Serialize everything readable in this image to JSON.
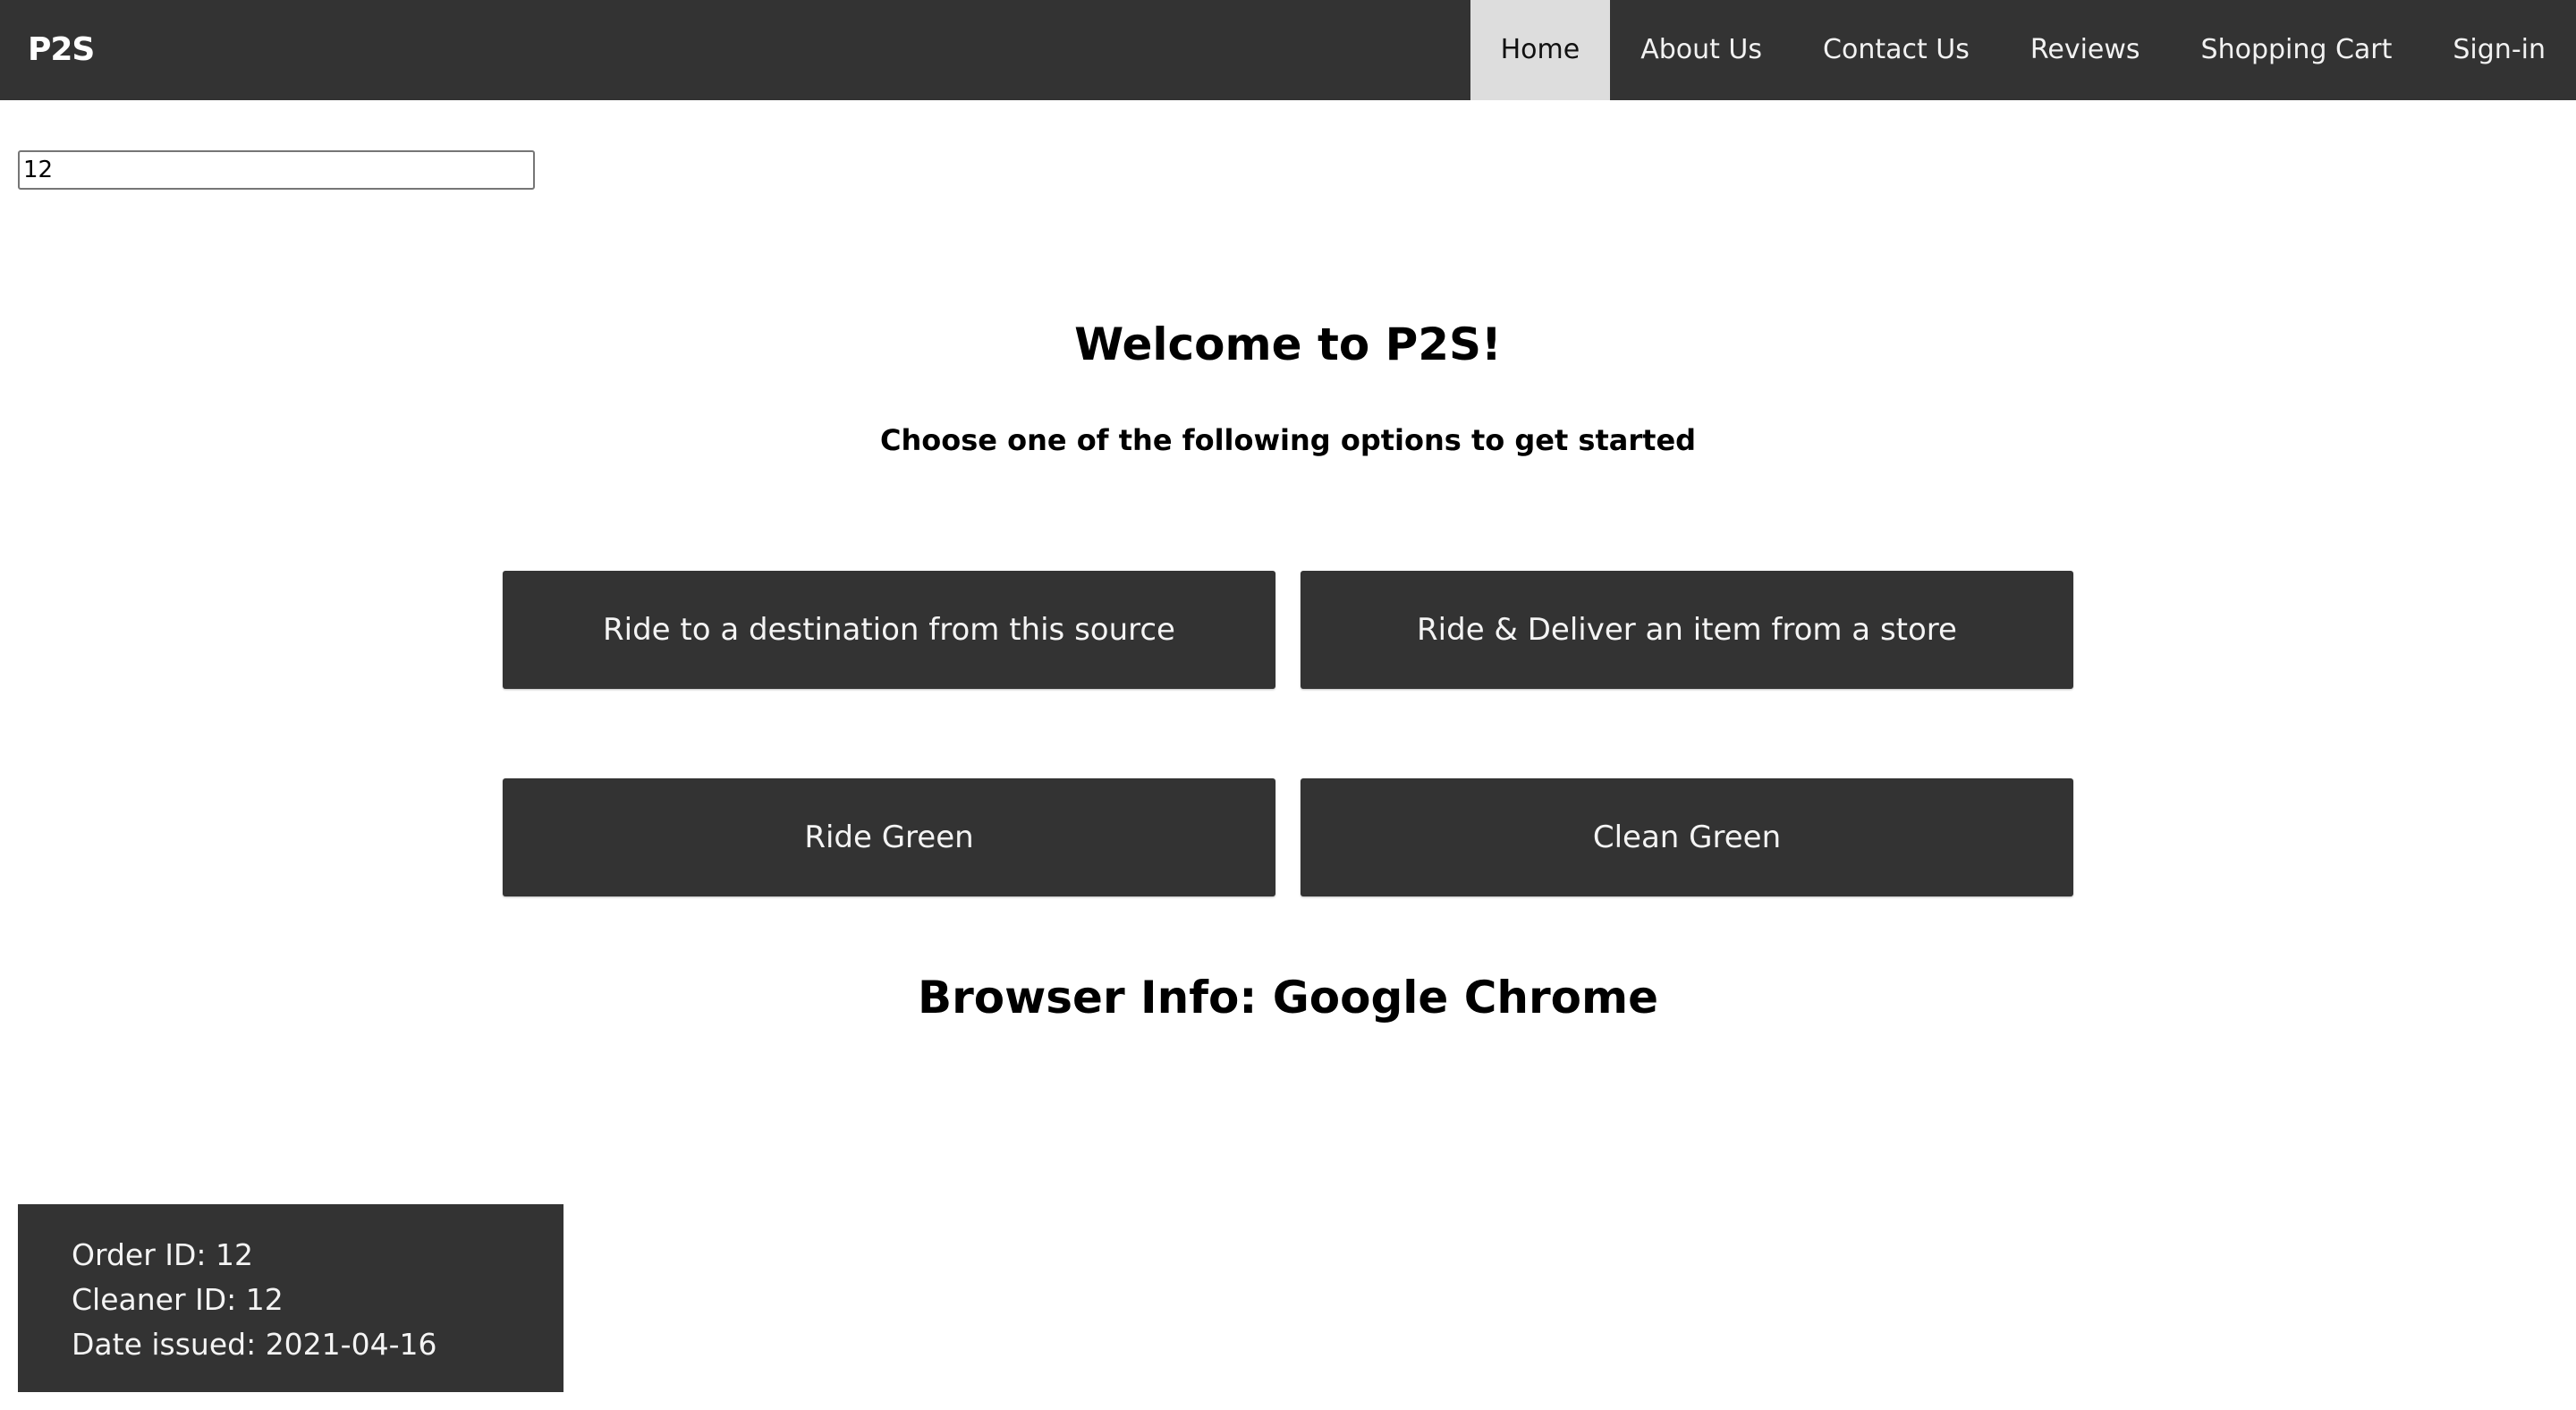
{
  "navbar": {
    "brand": "P2S",
    "links": [
      {
        "label": "Home",
        "active": true
      },
      {
        "label": "About Us",
        "active": false
      },
      {
        "label": "Contact Us",
        "active": false
      },
      {
        "label": "Reviews",
        "active": false
      },
      {
        "label": "Shopping Cart",
        "active": false
      },
      {
        "label": "Sign-in",
        "active": false
      }
    ]
  },
  "search": {
    "value": "12"
  },
  "main": {
    "title": "Welcome to P2S!",
    "subtitle": "Choose one of the following options to get started",
    "options": [
      {
        "label": "Ride to a destination from this source"
      },
      {
        "label": "Ride & Deliver an item from a store"
      },
      {
        "label": "Ride Green"
      },
      {
        "label": "Clean Green"
      }
    ],
    "browser_info": "Browser Info: Google Chrome"
  },
  "order_panel": {
    "order_id": "Order ID: 12",
    "cleaner_id": "Cleaner ID: 12",
    "date_issued": "Date issued: 2021-04-16"
  },
  "colors": {
    "navbar_bg": "#333333",
    "active_tab_bg": "#dddddd",
    "button_bg": "#333333",
    "page_bg": "#ffffff"
  }
}
